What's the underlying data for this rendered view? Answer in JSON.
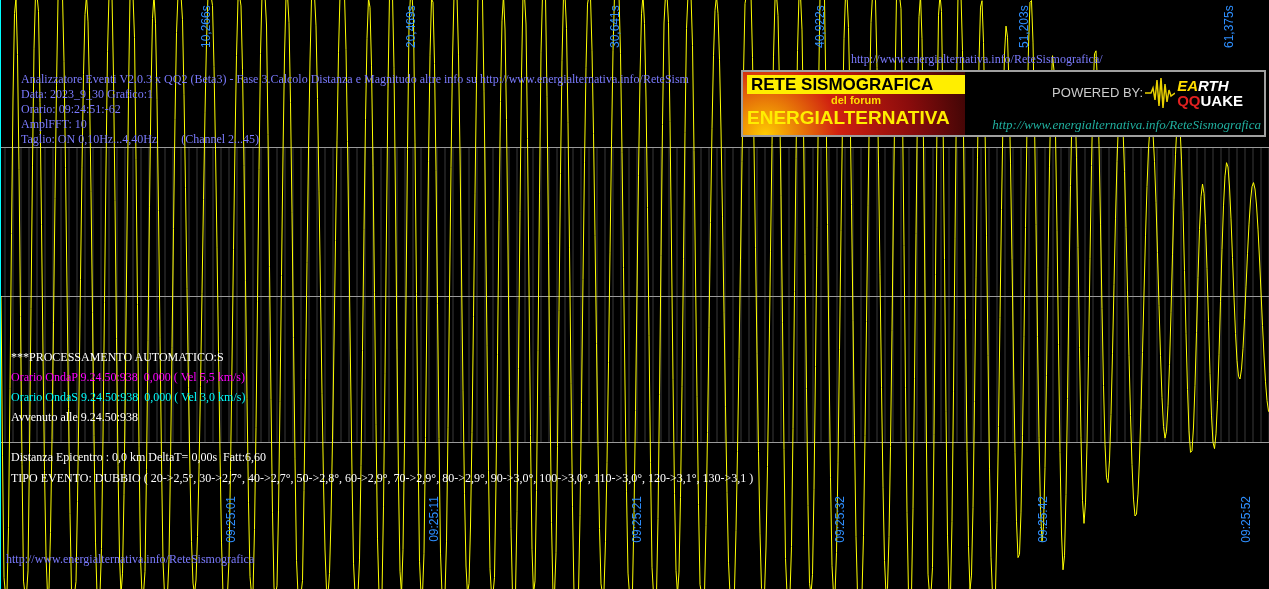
{
  "header": {
    "lines": [
      "Analizzatore Eventi V2.0.3 x QQ2 (Beta3) - Fase 3.Calcolo Distanza e Magnitudo altre info su http://www.energialternativa.info/ReteSism",
      "Data: 2023_9_30 Grafico:1",
      "Orario: 09:24:51:-62",
      "AmplFFT: 10",
      "Taglio: ON 0,10Hz...4,40Hz        (Channel 2...45)"
    ]
  },
  "top_url": "http://www.energialternativa.info/ReteSismografica/",
  "logo": {
    "title": "RETE SISMOGRAFICA",
    "subtitle": "del forum",
    "name": "ENERGIALTERNATIVA",
    "powered_by": "POWERED BY:",
    "brand_line_1": "EARTH",
    "brand_line_2": "QQUAKE",
    "url": "http://www.energialternativa.info/ReteSismografica"
  },
  "time_axis_top": [
    "10,266s",
    "20,469s",
    "30,641s",
    "40,922s",
    "51,203s",
    "61,375s"
  ],
  "time_axis_bottom": [
    "09:25:01",
    "09:25:11",
    "09:25:21",
    "09:25:32",
    "09:25:42",
    "09:25:52"
  ],
  "processing": [
    {
      "text": "***PROCESSAMENTO AUTOMATICO:S",
      "color": "#ffffff"
    },
    {
      "text": "Orario OndaP 9.24.50:938  0,000 ( Vel 5,5 km/s)",
      "color": "#ff00ff"
    },
    {
      "text": "Orario OndaS 9.24.50:938  0,000 ( Vel 3,0 km/s)",
      "color": "#00ffff"
    },
    {
      "text": "Avvenuto alle 9.24.50:938",
      "color": "#ffffff"
    }
  ],
  "result": [
    "Distanza Epicentro : 0,0 km DeltaT= 0,00s  Fatt:6,60",
    "TIPO EVENTO: DUBBIO ( 20->2,5°, 30->2,7°, 40->2,7°, 50->2,8°, 60->2,9°, 70->2,9°, 80->2,9°, 90->3,0°, 100->3,0°, 110->3,0°, 120->3,1°, 130->3,1 )"
  ],
  "footer_url": "http://www.energialternativa.info/ReteSismografica"
}
